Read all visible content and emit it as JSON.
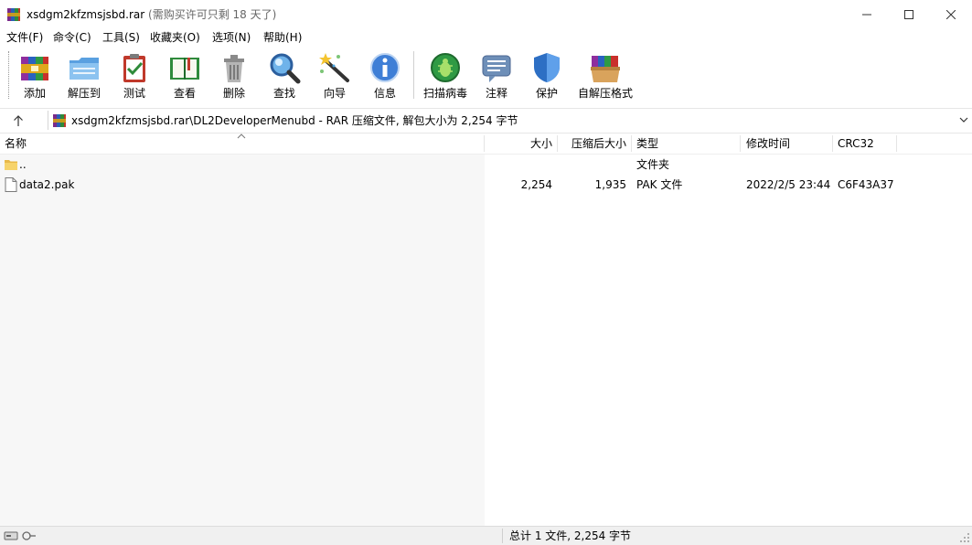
{
  "window": {
    "title": "xsdgm2kfzmsjsbd.rar",
    "subtitle": "(需购买许可只剩 18 天了)"
  },
  "menu": [
    "文件(F)",
    "命令(C)",
    "工具(S)",
    "收藏夹(O)",
    "选项(N)",
    "帮助(H)"
  ],
  "toolbar": {
    "add": "添加",
    "extract_to": "解压到",
    "test": "测试",
    "view": "查看",
    "delete": "删除",
    "find": "查找",
    "wizard": "向导",
    "info": "信息",
    "virus_scan": "扫描病毒",
    "comment": "注释",
    "protect": "保护",
    "sfx": "自解压格式"
  },
  "address": {
    "path": "xsdgm2kfzmsjsbd.rar\\DL2DeveloperMenubd - RAR 压缩文件, 解包大小为 2,254 字节"
  },
  "columns": {
    "name": "名称",
    "size": "大小",
    "packed": "压缩后大小",
    "type": "类型",
    "modified": "修改时间",
    "crc": "CRC32"
  },
  "rows": [
    {
      "name": "..",
      "size": "",
      "packed": "",
      "type": "文件夹",
      "modified": "",
      "crc": ""
    },
    {
      "name": "data2.pak",
      "size": "2,254",
      "packed": "1,935",
      "type": "PAK 文件",
      "modified": "2022/2/5 23:44",
      "crc": "C6F43A37"
    }
  ],
  "status": {
    "summary": "总计 1 文件, 2,254 字节"
  }
}
